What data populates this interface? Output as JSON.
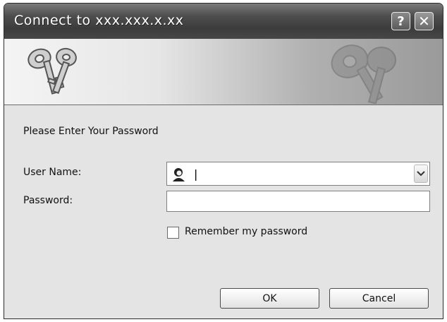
{
  "window": {
    "title": "Connect to xxx.xxx.x.xx",
    "help_label": "?",
    "close_label": "✕"
  },
  "form": {
    "prompt": "Please Enter Your Password",
    "username_label": "User Name:",
    "username_value": "|",
    "password_label": "Password:",
    "password_value": "",
    "remember_label": "Remember my password",
    "remember_checked": false
  },
  "buttons": {
    "ok_label": "OK",
    "cancel_label": "Cancel"
  },
  "icons": {
    "banner": "keys-icon",
    "user": "user-icon",
    "dropdown": "chevron-down-icon"
  }
}
